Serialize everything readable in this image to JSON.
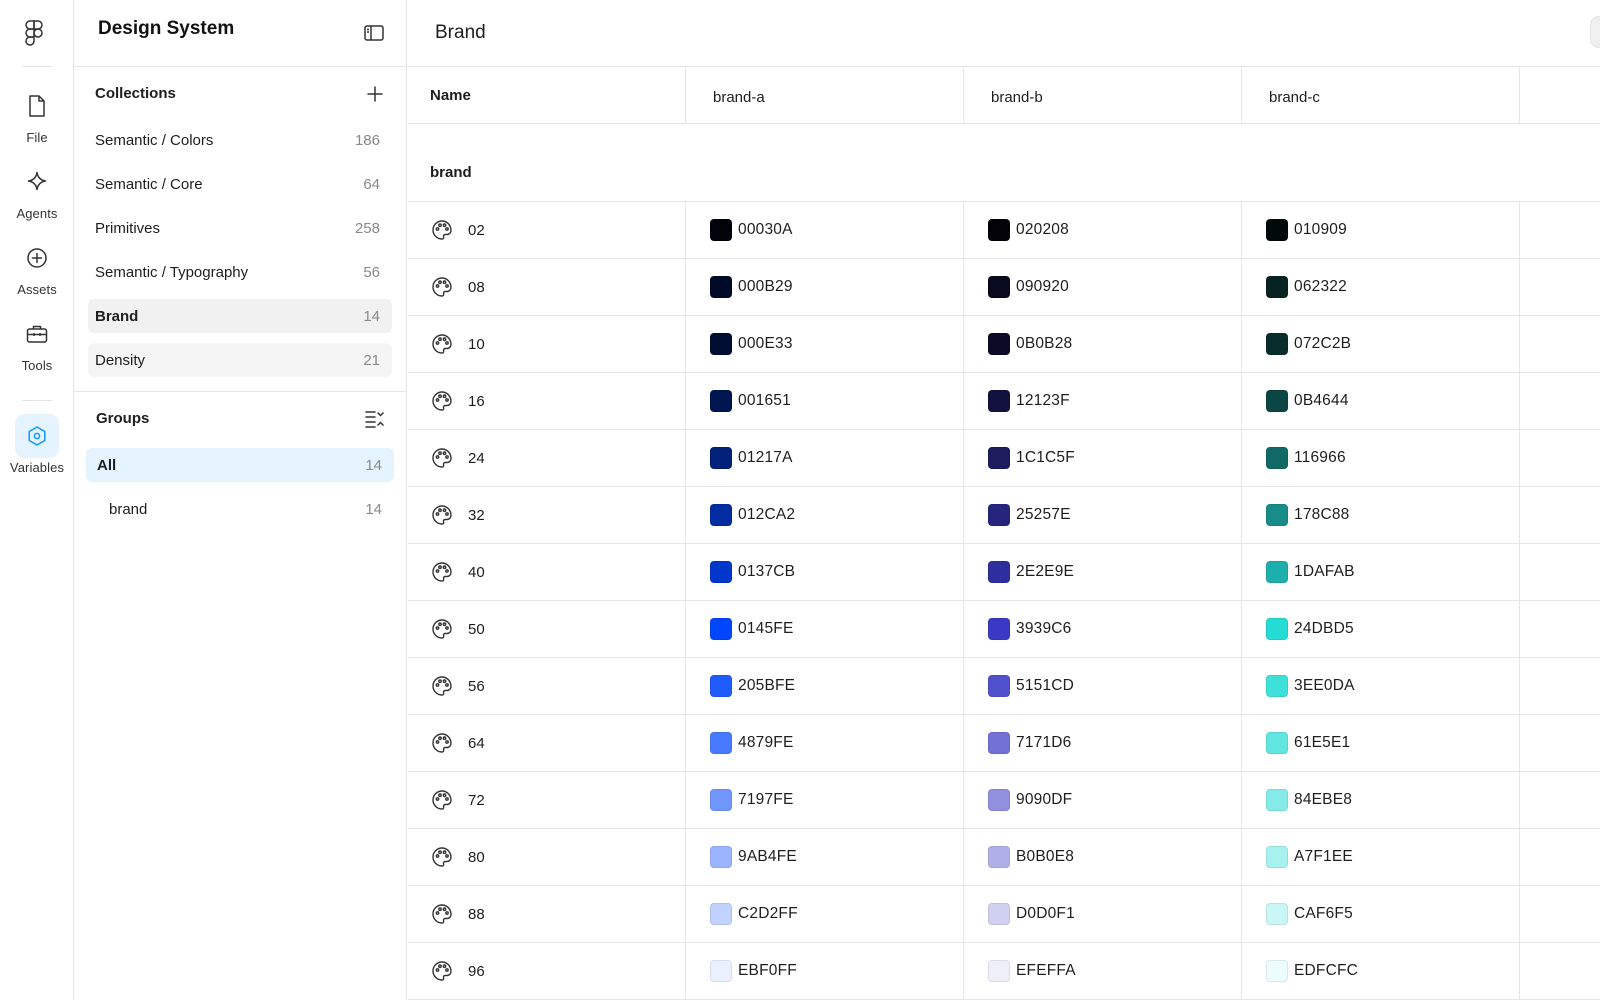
{
  "rail": {
    "items": [
      {
        "label": "File",
        "icon": "file-icon"
      },
      {
        "label": "Agents",
        "icon": "agents-sparkle-icon"
      },
      {
        "label": "Assets",
        "icon": "assets-plus-icon"
      },
      {
        "label": "Tools",
        "icon": "toolbox-icon"
      },
      {
        "label": "Variables",
        "icon": "variables-hexagon-icon",
        "active": true
      }
    ]
  },
  "panel": {
    "title": "Design System",
    "collections_title": "Collections",
    "collections": [
      {
        "name": "Semantic / Colors",
        "count": "186"
      },
      {
        "name": "Semantic / Core",
        "count": "64"
      },
      {
        "name": "Primitives",
        "count": "258"
      },
      {
        "name": "Semantic / Typography",
        "count": "56"
      },
      {
        "name": "Brand",
        "count": "14"
      },
      {
        "name": "Density",
        "count": "21"
      }
    ],
    "groups_title": "Groups",
    "groups": [
      {
        "name": "All",
        "count": "14"
      },
      {
        "name": "brand",
        "count": "14"
      }
    ]
  },
  "main": {
    "title": "Brand",
    "columns": [
      "Name",
      "brand-a",
      "brand-b",
      "brand-c"
    ],
    "group_label": "brand",
    "rows": [
      {
        "name": "02",
        "a": "00030A",
        "b": "020208",
        "c": "010909"
      },
      {
        "name": "08",
        "a": "000B29",
        "b": "090920",
        "c": "062322"
      },
      {
        "name": "10",
        "a": "000E33",
        "b": "0B0B28",
        "c": "072C2B"
      },
      {
        "name": "16",
        "a": "001651",
        "b": "12123F",
        "c": "0B4644"
      },
      {
        "name": "24",
        "a": "01217A",
        "b": "1C1C5F",
        "c": "116966"
      },
      {
        "name": "32",
        "a": "012CA2",
        "b": "25257E",
        "c": "178C88"
      },
      {
        "name": "40",
        "a": "0137CB",
        "b": "2E2E9E",
        "c": "1DAFAB"
      },
      {
        "name": "50",
        "a": "0145FE",
        "b": "3939C6",
        "c": "24DBD5"
      },
      {
        "name": "56",
        "a": "205BFE",
        "b": "5151CD",
        "c": "3EE0DA"
      },
      {
        "name": "64",
        "a": "4879FE",
        "b": "7171D6",
        "c": "61E5E1"
      },
      {
        "name": "72",
        "a": "7197FE",
        "b": "9090DF",
        "c": "84EBE8"
      },
      {
        "name": "80",
        "a": "9AB4FE",
        "b": "B0B0E8",
        "c": "A7F1EE"
      },
      {
        "name": "88",
        "a": "C2D2FF",
        "b": "D0D0F1",
        "c": "CAF6F5"
      },
      {
        "name": "96",
        "a": "EBF0FF",
        "b": "EFEFFA",
        "c": "EDFCFC"
      }
    ]
  },
  "colors": {
    "accent": "#0D99FF",
    "selected_group_bg": "#E5F3FF",
    "selected_collection_bg": "#F1F1F1"
  }
}
